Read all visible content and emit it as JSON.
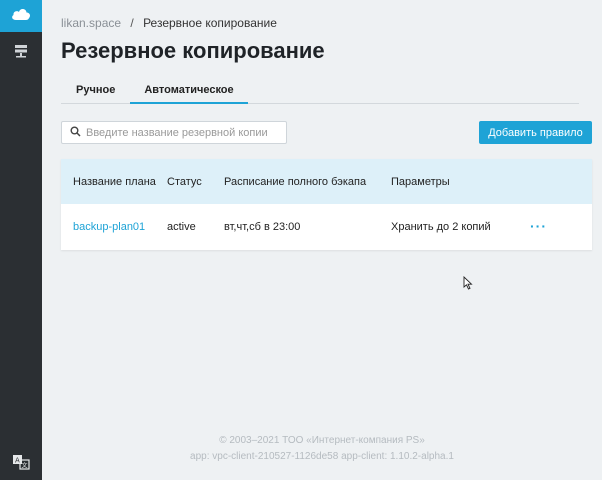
{
  "sidebar": {
    "top_icon": "cloud-icon",
    "items": [
      {
        "icon": "server-icon"
      }
    ],
    "lang_icon": "translate-icon"
  },
  "breadcrumb": {
    "root": "likan.space",
    "separator": "/",
    "current": "Резервное копирование"
  },
  "page_title": "Резервное копирование",
  "tabs": [
    {
      "label": "Ручное",
      "active": false
    },
    {
      "label": "Автоматическое",
      "active": true
    }
  ],
  "search": {
    "placeholder": "Введите название резервной копии",
    "value": ""
  },
  "add_button_label": "Добавить правило",
  "table": {
    "headers": [
      "Название плана",
      "Статус",
      "Расписание полного бэкапа",
      "Параметры"
    ],
    "rows": [
      {
        "name": "backup-plan01",
        "status": "active",
        "schedule": "вт,чт,сб в 23:00",
        "params": "Хранить до 2 копий",
        "actions": "···"
      }
    ]
  },
  "footer": {
    "copyright": "© 2003–2021 ТОО «Интернет-компания PS»",
    "version": "app: vpc-client-210527-1126de58 app-client: 1.10.2-alpha.1"
  },
  "colors": {
    "accent": "#1ea3d6",
    "sidebar": "#2b2f33",
    "background": "#eef1f3",
    "table_header": "#ddf0f9"
  }
}
